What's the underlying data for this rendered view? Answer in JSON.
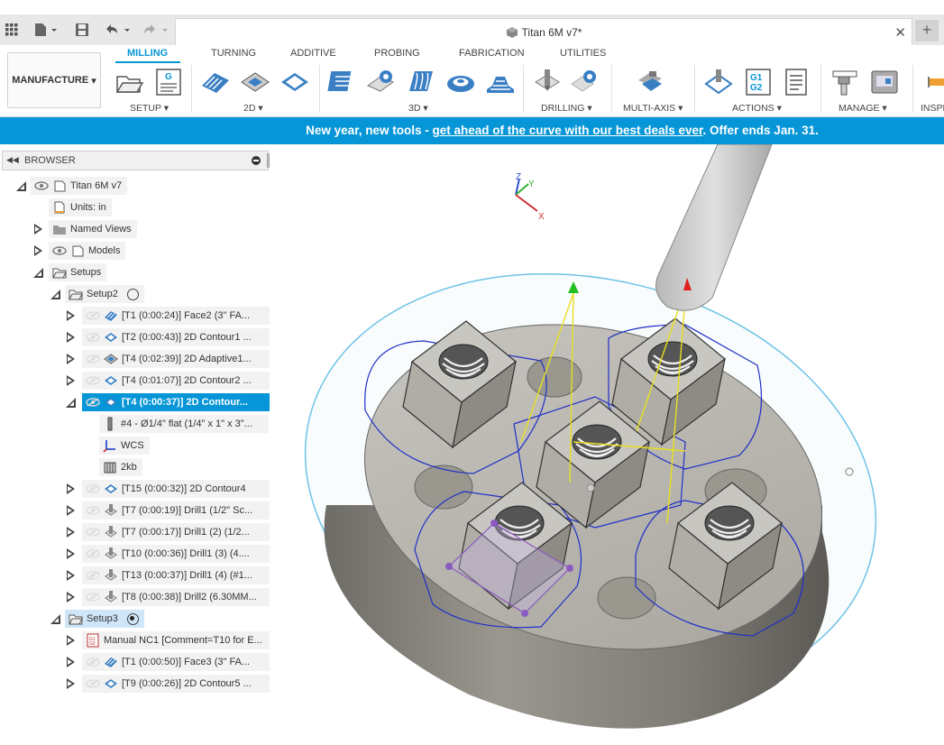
{
  "app": {
    "document_title": "Titan 6M v7*",
    "new_tab_icon": "plus-icon",
    "close_icon": "close-icon"
  },
  "ribbon": {
    "workspace_label": "MANUFACTURE",
    "tabs": [
      "MILLING",
      "TURNING",
      "ADDITIVE",
      "PROBING",
      "FABRICATION",
      "UTILITIES"
    ],
    "active_tab": "MILLING",
    "groups": {
      "setup": "SETUP",
      "twod": "2D",
      "threed": "3D",
      "drilling": "DRILLING",
      "multiaxis": "MULTI-AXIS",
      "actions": "ACTIONS",
      "manage": "MANAGE",
      "inspect": "INSPE"
    },
    "actions_g_code": "G1\nG2",
    "setup_g": "G"
  },
  "banner": {
    "prefix": "New year, new tools - ",
    "link": "get ahead of the curve with our best deals ever",
    "suffix": ". Offer ends Jan. 31."
  },
  "browser": {
    "title": "BROWSER",
    "root": "Titan 6M v7",
    "units": "Units: in",
    "named_views": "Named Views",
    "models": "Models",
    "setups": "Setups",
    "setup2": "Setup2",
    "ops1": [
      "[T1 (0:00:24)] Face2 (3\" FA...",
      "[T2 (0:00:43)] 2D Contour1 ...",
      "[T4 (0:02:39)] 2D Adaptive1...",
      "[T4 (0:01:07)] 2D Contour2 ...",
      "[T4 (0:00:37)] 2D Contour..."
    ],
    "tool": "#4 - Ø1/4\" flat (1/4\" x 1\" x 3\"...",
    "wcs": "WCS",
    "stock": "2kb",
    "ops2": [
      "[T15 (0:00:32)] 2D Contour4",
      "[T7 (0:00:19)] Drill1 (1/2\" Sc...",
      "[T7 (0:00:17)] Drill1 (2) (1/2...",
      "[T10 (0:00:36)] Drill1 (3) (4....",
      "[T13 (0:00:37)] Drill1 (4) (#1...",
      "[T8 (0:00:38)] Drill2 (6.30MM..."
    ],
    "setup3": "Setup3",
    "ops3": [
      "Manual NC1 [Comment=T10 for E...",
      "[T1 (0:00:50)] Face3 (3\" FA...",
      "[T9 (0:00:26)] 2D Contour5 ..."
    ]
  },
  "viewport": {
    "triad": {
      "z": "Z",
      "y": "Y",
      "x": "X"
    }
  },
  "colors": {
    "accent": "#0696d7",
    "selected_text": "#ffffff",
    "toolpath": "#2030c8",
    "stock_outline": "#6ec3e8"
  }
}
